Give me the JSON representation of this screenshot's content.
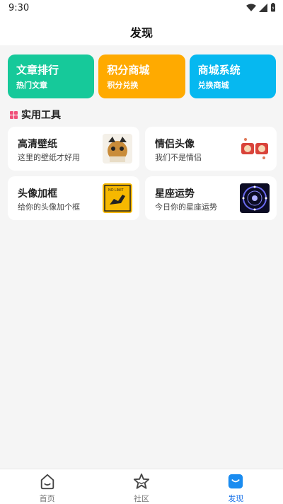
{
  "status": {
    "time": "9:30"
  },
  "header": {
    "title": "发现"
  },
  "feature_cards": [
    {
      "title": "文章排行",
      "subtitle": "热门文章",
      "color": "#16c99a"
    },
    {
      "title": "积分商城",
      "subtitle": "积分兑换",
      "color": "#ffaa00"
    },
    {
      "title": "商城系统",
      "subtitle": "兑换商城",
      "color": "#06b8f0"
    }
  ],
  "section": {
    "title": "实用工具"
  },
  "tools": [
    {
      "title": "高清壁纸",
      "subtitle": "这里的壁纸才好用",
      "icon": "wallpaper-thumbnail"
    },
    {
      "title": "情侣头像",
      "subtitle": "我们不是情侣",
      "icon": "couple-avatar-thumbnail"
    },
    {
      "title": "头像加框",
      "subtitle": "给你的头像加个框",
      "icon": "avatar-frame-thumbnail"
    },
    {
      "title": "星座运势",
      "subtitle": "今日你的星座运势",
      "icon": "horoscope-thumbnail"
    }
  ],
  "sign_text": "NO LIMIT",
  "tabbar": {
    "items": [
      {
        "label": "首页",
        "icon": "home-icon"
      },
      {
        "label": "社区",
        "icon": "star-icon"
      },
      {
        "label": "发现",
        "icon": "shopping-bag-icon",
        "active": true
      }
    ]
  }
}
